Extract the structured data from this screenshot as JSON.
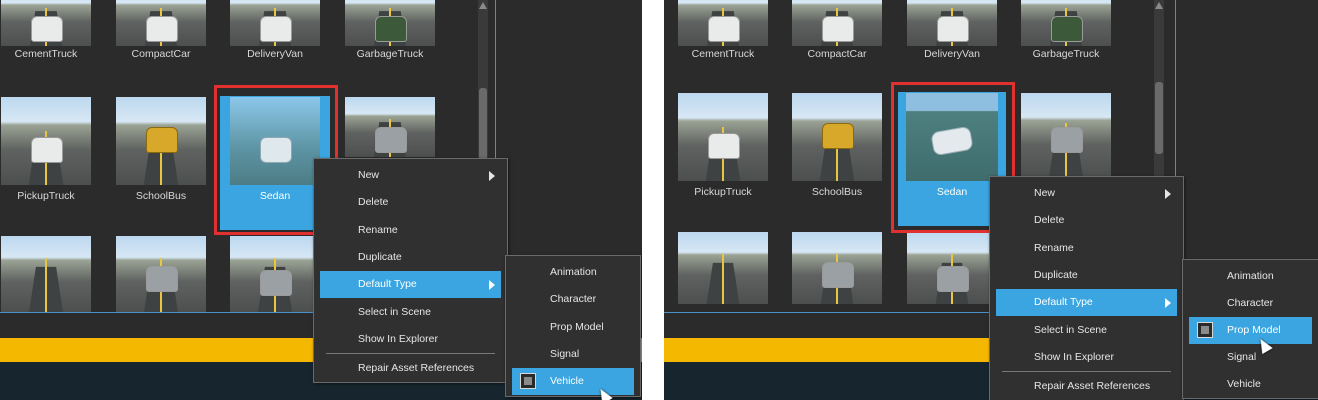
{
  "left": {
    "assets": {
      "row1": [
        "CementTruck",
        "CompactCar",
        "DeliveryVan",
        "GarbageTruck"
      ],
      "row2": [
        "PickupTruck",
        "SchoolBus",
        "Sedan"
      ],
      "selected": "Sedan"
    },
    "context_menu": {
      "items": [
        "New",
        "Delete",
        "Rename",
        "Duplicate",
        "Default Type",
        "Select in Scene",
        "Show In Explorer",
        "Repair Asset References"
      ],
      "highlighted": "Default Type"
    },
    "submenu": {
      "items": [
        "Animation",
        "Character",
        "Prop Model",
        "Signal",
        "Vehicle"
      ],
      "checked": "Vehicle"
    }
  },
  "right": {
    "assets": {
      "row1": [
        "CementTruck",
        "CompactCar",
        "DeliveryVan",
        "GarbageTruck"
      ],
      "row2": [
        "PickupTruck",
        "SchoolBus",
        "Sedan"
      ],
      "selected": "Sedan"
    },
    "context_menu": {
      "items": [
        "New",
        "Delete",
        "Rename",
        "Duplicate",
        "Default Type",
        "Select in Scene",
        "Show In Explorer",
        "Repair Asset References"
      ],
      "highlighted": "Default Type"
    },
    "submenu": {
      "items": [
        "Animation",
        "Character",
        "Prop Model",
        "Signal",
        "Vehicle"
      ],
      "checked": "Prop Model"
    }
  },
  "colors": {
    "panel_bg": "#2b2b2b",
    "selection_blue": "#3aa5e0",
    "highlight_box": "#e03030",
    "accent_bar": "#f5b800"
  }
}
